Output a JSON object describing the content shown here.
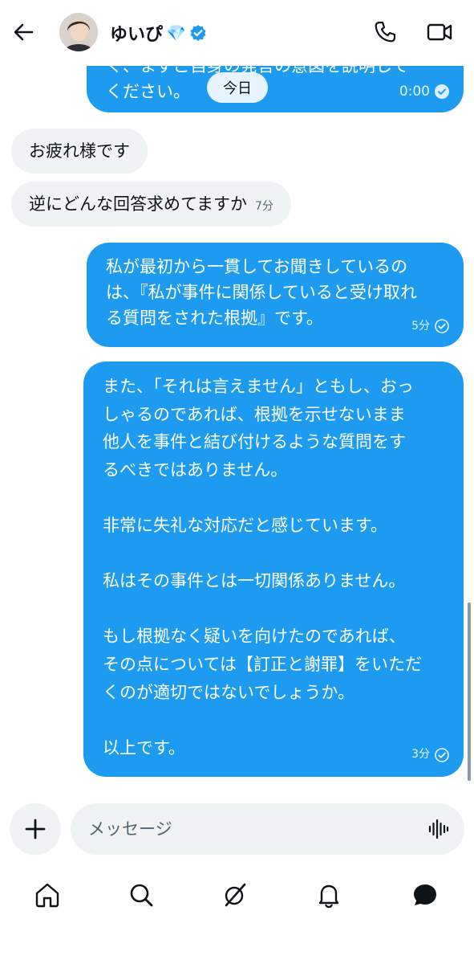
{
  "header": {
    "name": "ゆいぴ",
    "name_emoji": "💎"
  },
  "date_label": "今日",
  "messages": {
    "top": {
      "lines": [
        "く、まずご自身の発言の意図を説明して",
        "ください。"
      ],
      "time": "0:00"
    },
    "in1": {
      "text": "お疲れ様です"
    },
    "in2": {
      "text": "逆にどんな回答求めてますか",
      "time": "7分"
    },
    "out1": {
      "lines": [
        "私が最初から一貫してお聞きしているの",
        "は、『私が事件に関係していると受け取れ",
        "る質問をされた根拠』です。"
      ],
      "time": "5分"
    },
    "out2": {
      "lines": [
        "また、「それは言えません」ともし、おっ",
        "しゃるのであれば、根拠を示せないまま",
        "他人を事件と結び付けるような質問をす",
        "るべきではありません。",
        "",
        "非常に失礼な対応だと感じています。",
        "",
        "私はその事件とは一切関係ありません。",
        "",
        "もし根拠なく疑いを向けたのであれば、",
        "その点については【訂正と謝罪】をいただ",
        "くのが適切ではないでしょうか。",
        "",
        "以上です。"
      ],
      "time": "3分"
    }
  },
  "composer": {
    "placeholder": "メッセージ"
  },
  "colors": {
    "accent": "#1d9bf0",
    "incoming_bg": "#eff3f4"
  },
  "nav": {
    "items": [
      "home-icon",
      "search-icon",
      "grok-icon",
      "notifications-icon",
      "messages-icon"
    ]
  }
}
